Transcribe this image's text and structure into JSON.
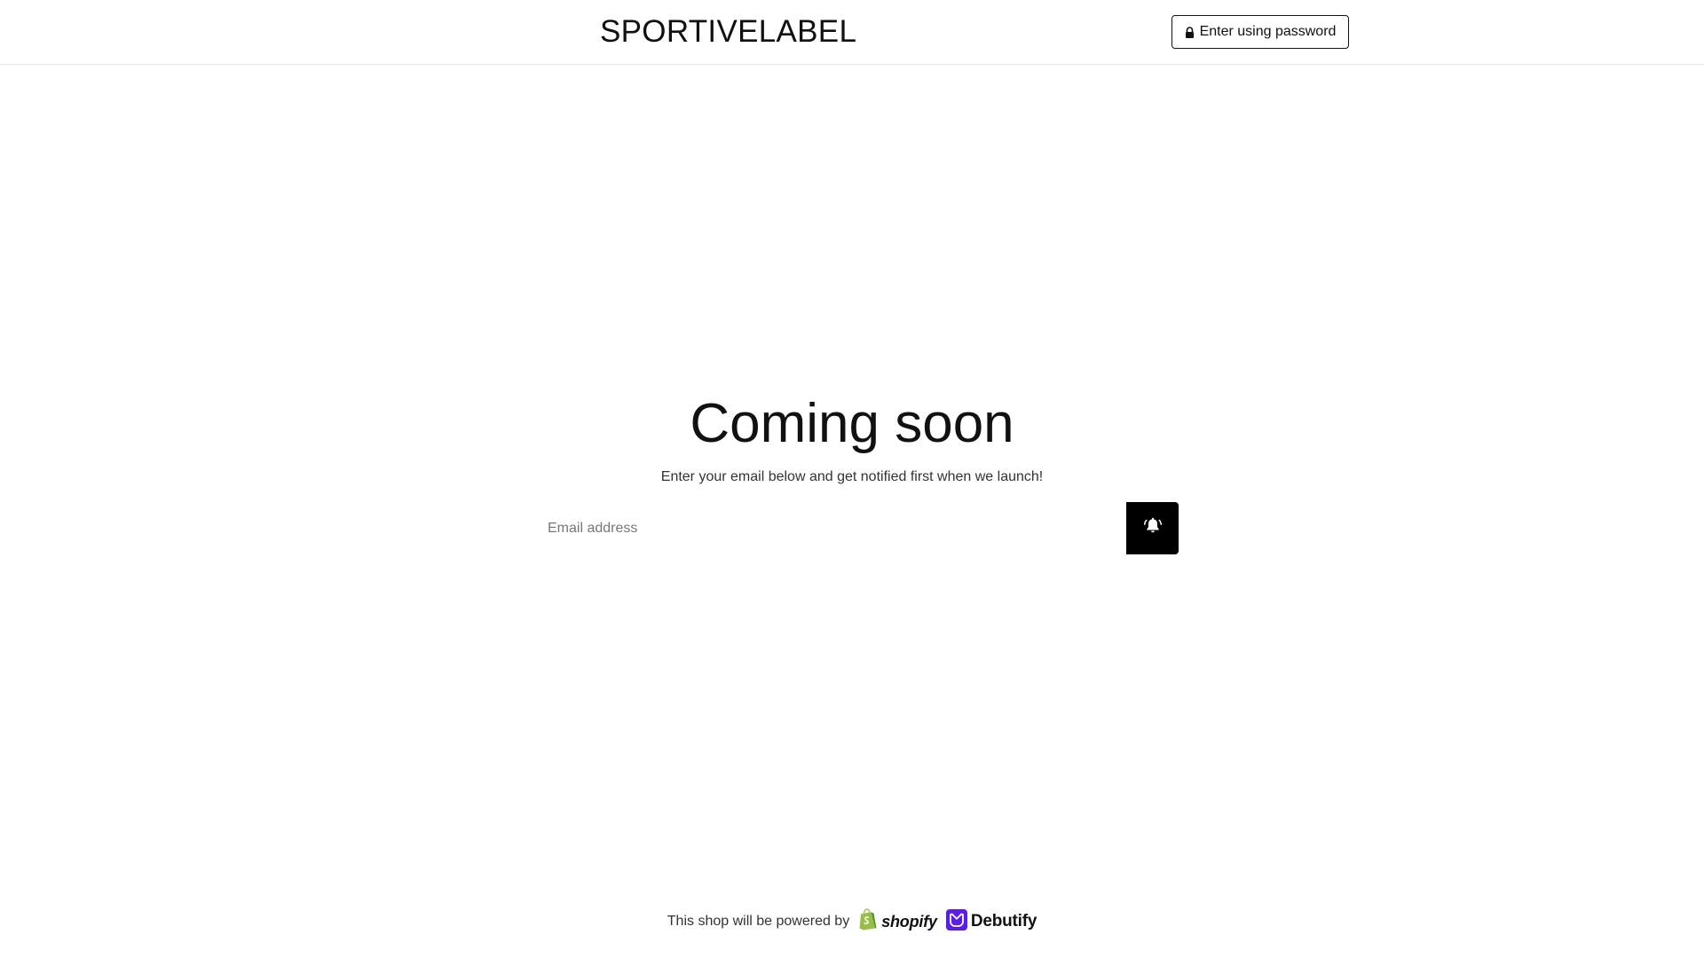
{
  "header": {
    "brand": "SPORTIVELABEL",
    "password_button_label": "Enter using password",
    "password_button_icon": "lock-icon"
  },
  "main": {
    "title": "Coming soon",
    "subtitle": "Enter your email below and get notified first when we launch!",
    "email_placeholder": "Email address",
    "email_value": "",
    "notify_button_icon": "bell-ring-icon"
  },
  "footer": {
    "powered_by_text": "This shop will be powered by",
    "shopify_label": "shopify",
    "debutify_label": "Debutify"
  },
  "colors": {
    "background": "#ffffff",
    "text": "#111111",
    "button": "#000000",
    "shopify_green": "#95BF47",
    "debutify_purple": "#5C1EE6"
  }
}
